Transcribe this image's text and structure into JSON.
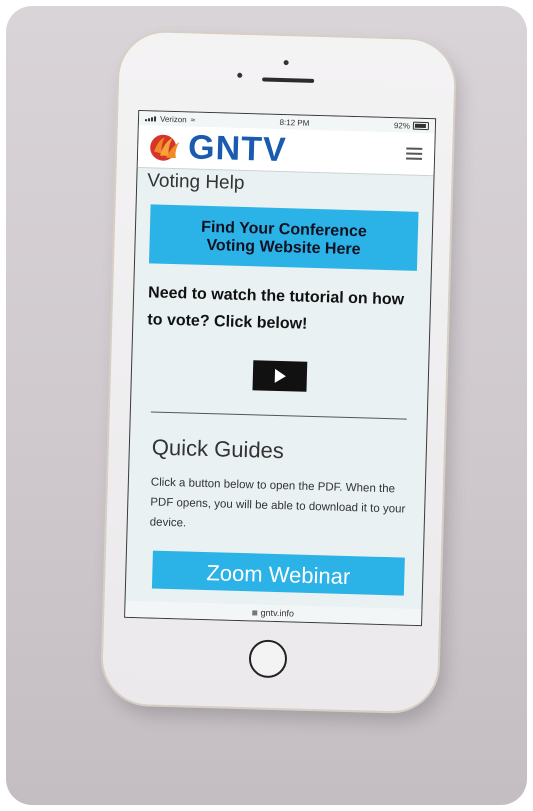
{
  "status": {
    "carrier": "Verizon",
    "time": "8:12 PM",
    "battery": "92%"
  },
  "header": {
    "logo_text": "GNTV"
  },
  "page": {
    "section_title": "Voting Help",
    "cta_line1": "Find Your Conference",
    "cta_line2": "Voting Website Here",
    "prompt_line1": "Need to watch the tutorial on how",
    "prompt_line2": "to vote? Click below!",
    "guides_title": "Quick Guides",
    "guides_text": "Click a button below to open the PDF. When the PDF opens, you will be able to download it to your device.",
    "zoom_button": "Zoom Webinar"
  },
  "browser": {
    "url": "gntv.info"
  },
  "colors": {
    "accent": "#2bb2e6",
    "logo_blue": "#1a5bb0",
    "logo_red": "#d8352a",
    "logo_orange": "#f08a24"
  }
}
